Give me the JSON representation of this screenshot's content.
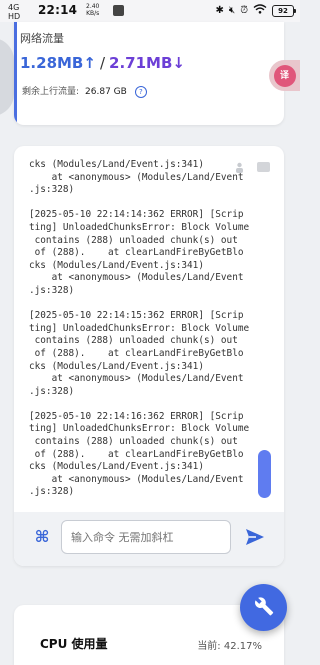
{
  "status_bar": {
    "network_top": "4G",
    "network_bottom": "HD",
    "time": "22:14",
    "speed_value": "2.40",
    "speed_unit": "KB/s",
    "battery": "92"
  },
  "traffic": {
    "title": "网络流量",
    "upload": "1.28MB",
    "upload_arrow": "↑",
    "separator": "/",
    "download": "2.71MB",
    "download_arrow": "↓",
    "remaining_label": "剩余上行流量:",
    "remaining_value": "26.87 GB",
    "help_glyph": "?"
  },
  "translate": {
    "label": "译"
  },
  "console": {
    "lines": [
      "cks (Modules/Land/Event.js:341)",
      "    at <anonymous> (Modules/Land/Event",
      ".js:328)",
      "",
      "[2025-05-10 22:14:14:362 ERROR] [Scrip",
      "ting] UnloadedChunksError: Block Volume",
      " contains (288) unloaded chunk(s) out",
      " of (288).    at clearLandFireByGetBlo",
      "cks (Modules/Land/Event.js:341)",
      "    at <anonymous> (Modules/Land/Event",
      ".js:328)",
      "",
      "[2025-05-10 22:14:15:362 ERROR] [Scrip",
      "ting] UnloadedChunksError: Block Volume",
      " contains (288) unloaded chunk(s) out",
      " of (288).    at clearLandFireByGetBlo",
      "cks (Modules/Land/Event.js:341)",
      "    at <anonymous> (Modules/Land/Event",
      ".js:328)",
      "",
      "[2025-05-10 22:14:16:362 ERROR] [Scrip",
      "ting] UnloadedChunksError: Block Volume",
      " contains (288) unloaded chunk(s) out",
      " of (288).    at clearLandFireByGetBlo",
      "cks (Modules/Land/Event.js:341)",
      "    at <anonymous> (Modules/Land/Event",
      ".js:328)"
    ],
    "command_glyph": "⌘",
    "input_placeholder": "输入命令 无需加斜杠"
  },
  "cpu": {
    "title": "CPU 使用量",
    "current": "当前: 42.17%"
  },
  "colors": {
    "accent": "#4169e1",
    "upload": "#3a66d8",
    "download": "#6c3fd6"
  },
  "icons": [
    "command-icon",
    "send-icon",
    "wrench-icon",
    "help-icon",
    "copy-icon",
    "translate-icon"
  ]
}
